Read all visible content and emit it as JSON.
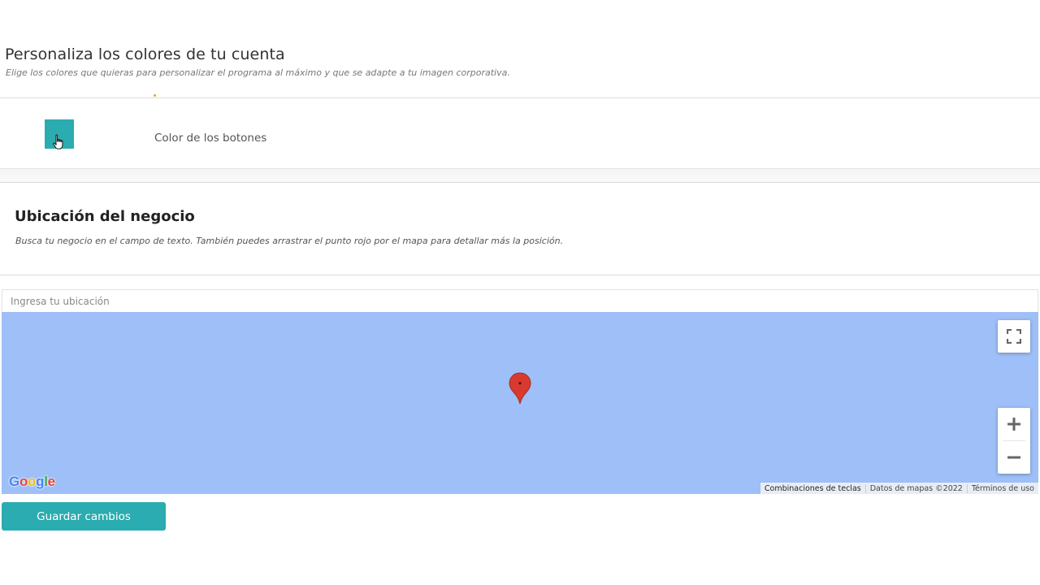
{
  "colors_section": {
    "title": "Personaliza los colores de tu cuenta",
    "subtitle": "Elige los colores que quieras para personalizar el programa al máximo y que se adapte a tu imagen corporativa.",
    "button_color_label": "Color de los botones",
    "button_color_value": "#2aacb0"
  },
  "location_section": {
    "title": "Ubicación del negocio",
    "subtitle": "Busca tu negocio en el campo de texto. También puedes arrastrar el punto rojo por el mapa para detallar más la posición.",
    "input_placeholder": "Ingresa tu ubicación"
  },
  "map": {
    "background_color": "#9ebff7",
    "pin_color": "#d93a2f",
    "zoom_in_label": "+",
    "zoom_out_label": "−",
    "logo_letters": [
      "G",
      "o",
      "o",
      "g",
      "l",
      "e"
    ],
    "attribution": {
      "shortcuts": "Combinaciones de teclas",
      "data": "Datos de mapas ©2022",
      "terms": "Términos de uso"
    }
  },
  "actions": {
    "save_label": "Guardar cambios"
  },
  "icons": [
    "cursor-hand-icon",
    "map-pin-icon",
    "fullscreen-icon",
    "zoom-in-icon",
    "zoom-out-icon",
    "google-logo"
  ]
}
